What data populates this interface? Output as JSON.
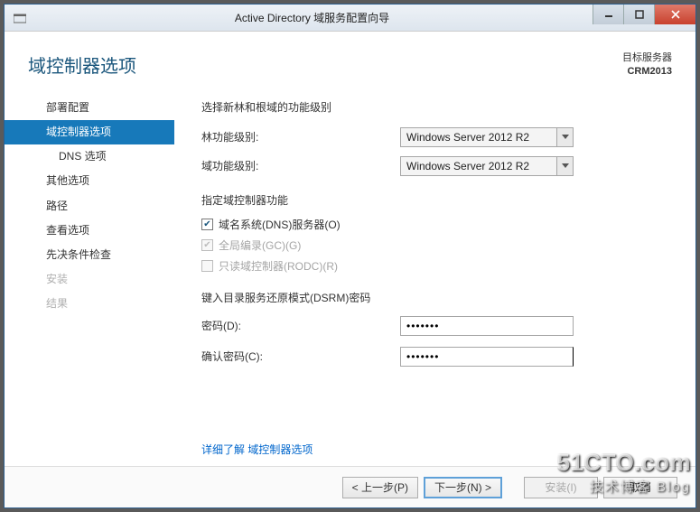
{
  "window": {
    "title": "Active Directory 域服务配置向导"
  },
  "header": {
    "page_title": "域控制器选项",
    "target_label": "目标服务器",
    "target_name": "CRM2013"
  },
  "sidebar": {
    "steps": [
      {
        "label": "部署配置"
      },
      {
        "label": "域控制器选项"
      },
      {
        "label": "DNS 选项"
      },
      {
        "label": "其他选项"
      },
      {
        "label": "路径"
      },
      {
        "label": "查看选项"
      },
      {
        "label": "先决条件检查"
      },
      {
        "label": "安装"
      },
      {
        "label": "结果"
      }
    ]
  },
  "main": {
    "functional_level_label": "选择新林和根域的功能级别",
    "forest_level_label": "林功能级别:",
    "forest_level_value": "Windows Server 2012 R2",
    "domain_level_label": "域功能级别:",
    "domain_level_value": "Windows Server 2012 R2",
    "capabilities_label": "指定域控制器功能",
    "cb_dns_label": "域名系统(DNS)服务器(O)",
    "cb_gc_label": "全局编录(GC)(G)",
    "cb_rodc_label": "只读域控制器(RODC)(R)",
    "dsrm_label": "键入目录服务还原模式(DSRM)密码",
    "password_label": "密码(D):",
    "password_value": "•••••••",
    "confirm_label": "确认密码(C):",
    "confirm_value": "•••••••",
    "more_link": "详细了解 域控制器选项"
  },
  "footer": {
    "prev": "< 上一步(P)",
    "next": "下一步(N) >",
    "install": "安装(I)",
    "cancel": "取消"
  },
  "watermark": {
    "line1": "51CTO.com",
    "line2": "技术博客  Blog"
  }
}
